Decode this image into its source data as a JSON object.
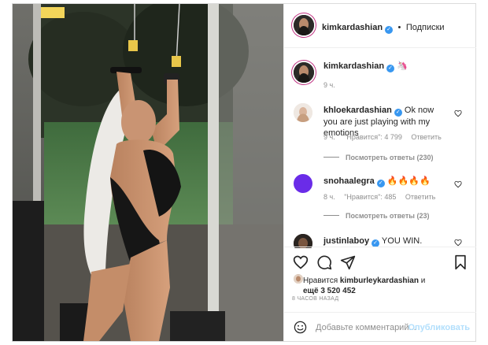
{
  "post": {
    "author": "kimkardashian",
    "follow_label": "Подписки",
    "caption_emoji": "🦄",
    "caption_time": "9 ч."
  },
  "comments": [
    {
      "username": "khloekardashian",
      "text": "Ok now you are just playing with my emotions",
      "time": "9 ч.",
      "likes_label": "\"Нравится\": 4 799",
      "reply_label": "Ответить",
      "view_replies": "Посмотреть ответы (230)"
    },
    {
      "username": "snohaalegra",
      "text": "🔥🔥🔥🔥",
      "time": "8 ч.",
      "likes_label": "\"Нравится\": 485",
      "reply_label": "Ответить",
      "view_replies": "Посмотреть ответы (23)"
    },
    {
      "username": "justinlaboy",
      "text": "YOU WIN. Nobody"
    }
  ],
  "likes": {
    "prefix": "Нравится",
    "user": "kimburleykardashian",
    "suffix": "и",
    "others": "ещё 3 520 452"
  },
  "timestamp": "8 ЧАСОВ НАЗАД",
  "add_comment": {
    "placeholder": "Добавьте комментарий...",
    "post_label": "Опубликовать"
  },
  "colors": {
    "accent_blue": "#3897f0",
    "snoha_avatar": "#6a2ce8",
    "muted": "#8e8e8e"
  },
  "icons": [
    "heart-icon",
    "comment-icon",
    "share-icon",
    "bookmark-icon",
    "emoji-icon",
    "verified-badge-icon"
  ]
}
